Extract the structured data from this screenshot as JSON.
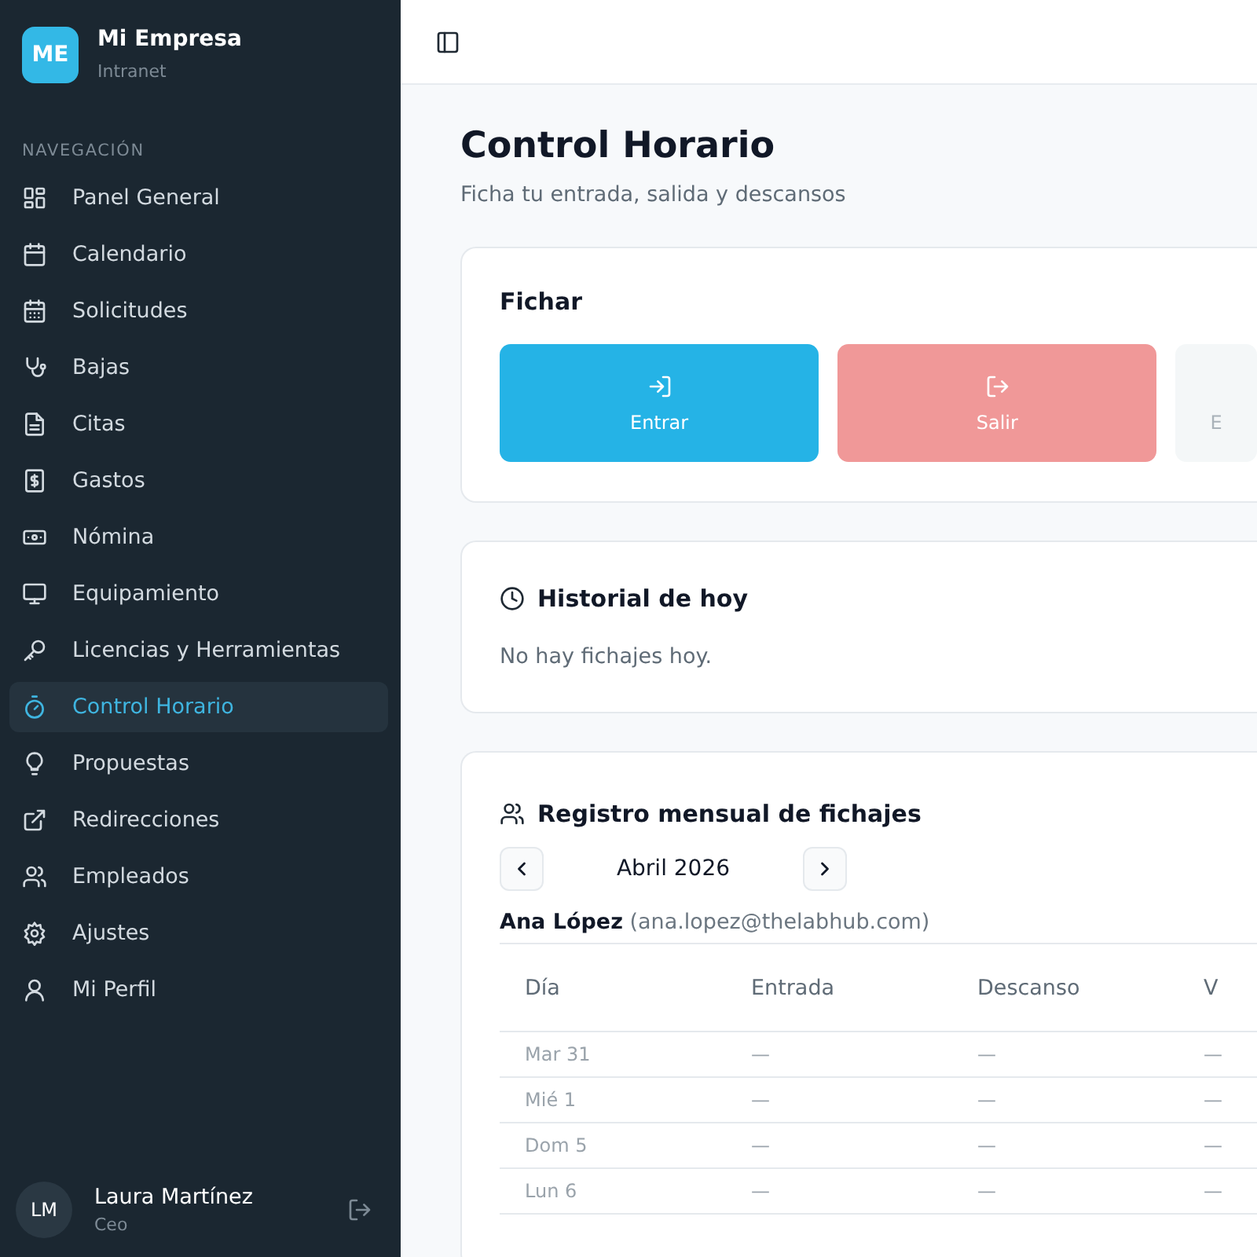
{
  "sidebar": {
    "brand": {
      "initials": "ME",
      "name": "Mi Empresa",
      "subtitle": "Intranet"
    },
    "section_label": "NAVEGACIÓN",
    "items": [
      {
        "label": "Panel General",
        "selected": false
      },
      {
        "label": "Calendario",
        "selected": false
      },
      {
        "label": "Solicitudes",
        "selected": false
      },
      {
        "label": "Bajas",
        "selected": false
      },
      {
        "label": "Citas",
        "selected": false
      },
      {
        "label": "Gastos",
        "selected": false
      },
      {
        "label": "Nómina",
        "selected": false
      },
      {
        "label": "Equipamiento",
        "selected": false
      },
      {
        "label": "Licencias y Herramientas",
        "selected": false
      },
      {
        "label": "Control Horario",
        "selected": true
      },
      {
        "label": "Propuestas",
        "selected": false
      },
      {
        "label": "Redirecciones",
        "selected": false
      },
      {
        "label": "Empleados",
        "selected": false
      },
      {
        "label": "Ajustes",
        "selected": false
      },
      {
        "label": "Mi Perfil",
        "selected": false
      }
    ],
    "user": {
      "initials": "LM",
      "name": "Laura Martínez",
      "role": "Ceo"
    }
  },
  "page": {
    "title": "Control Horario",
    "subtitle": "Ficha tu entrada, salida y descansos"
  },
  "clock_card": {
    "title": "Fichar",
    "buttons": [
      {
        "label": "Entrar",
        "kind": "enter",
        "disabled": false
      },
      {
        "label": "Salir",
        "kind": "exit",
        "disabled": true
      },
      {
        "label": "E",
        "kind": "break",
        "disabled": true
      }
    ]
  },
  "history_card": {
    "title": "Historial de hoy",
    "empty_text": "No hay fichajes hoy."
  },
  "monthly_card": {
    "title": "Registro mensual de fichajes",
    "month": "Abril 2026",
    "employee_name": "Ana López",
    "employee_email": "(ana.lopez@thelabhub.com)",
    "table": {
      "columns": [
        "Día",
        "Entrada",
        "Descanso",
        "V"
      ],
      "rows": [
        [
          "Mar 31",
          "—",
          "—",
          "—"
        ],
        [
          "Mié 1",
          "—",
          "—",
          "—"
        ],
        [
          "Dom 5",
          "—",
          "—",
          "—"
        ],
        [
          "Lun 6",
          "—",
          "—",
          "—"
        ]
      ]
    }
  }
}
